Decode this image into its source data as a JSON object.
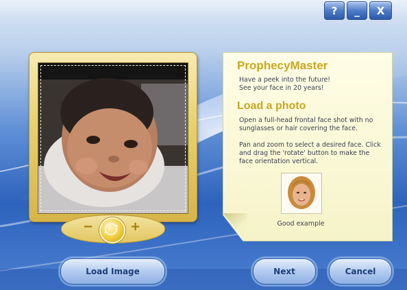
{
  "window": {
    "help_label": "?",
    "minimize_label": "_",
    "close_label": "X"
  },
  "photo": {
    "zoom_out_label": "−",
    "zoom_in_label": "+"
  },
  "info": {
    "app_title": "ProphecyMaster",
    "tagline_line1": "Have a peek into the future!",
    "tagline_line2": "See your face in 20 years!",
    "section_title": "Load a photo",
    "instruction_1": "Open a full-head frontal face shot with no sunglasses or hair covering the face.",
    "instruction_2": "Pan and zoom to select a desired face. Click and drag the 'rotate' button to make the face orientation vertical.",
    "example_caption": "Good example"
  },
  "buttons": {
    "load_image": "Load Image",
    "next": "Next",
    "cancel": "Cancel"
  },
  "colors": {
    "accent_gold": "#c9a620",
    "button_text": "#1f3f7a",
    "panel_bg": "#fffde6"
  }
}
